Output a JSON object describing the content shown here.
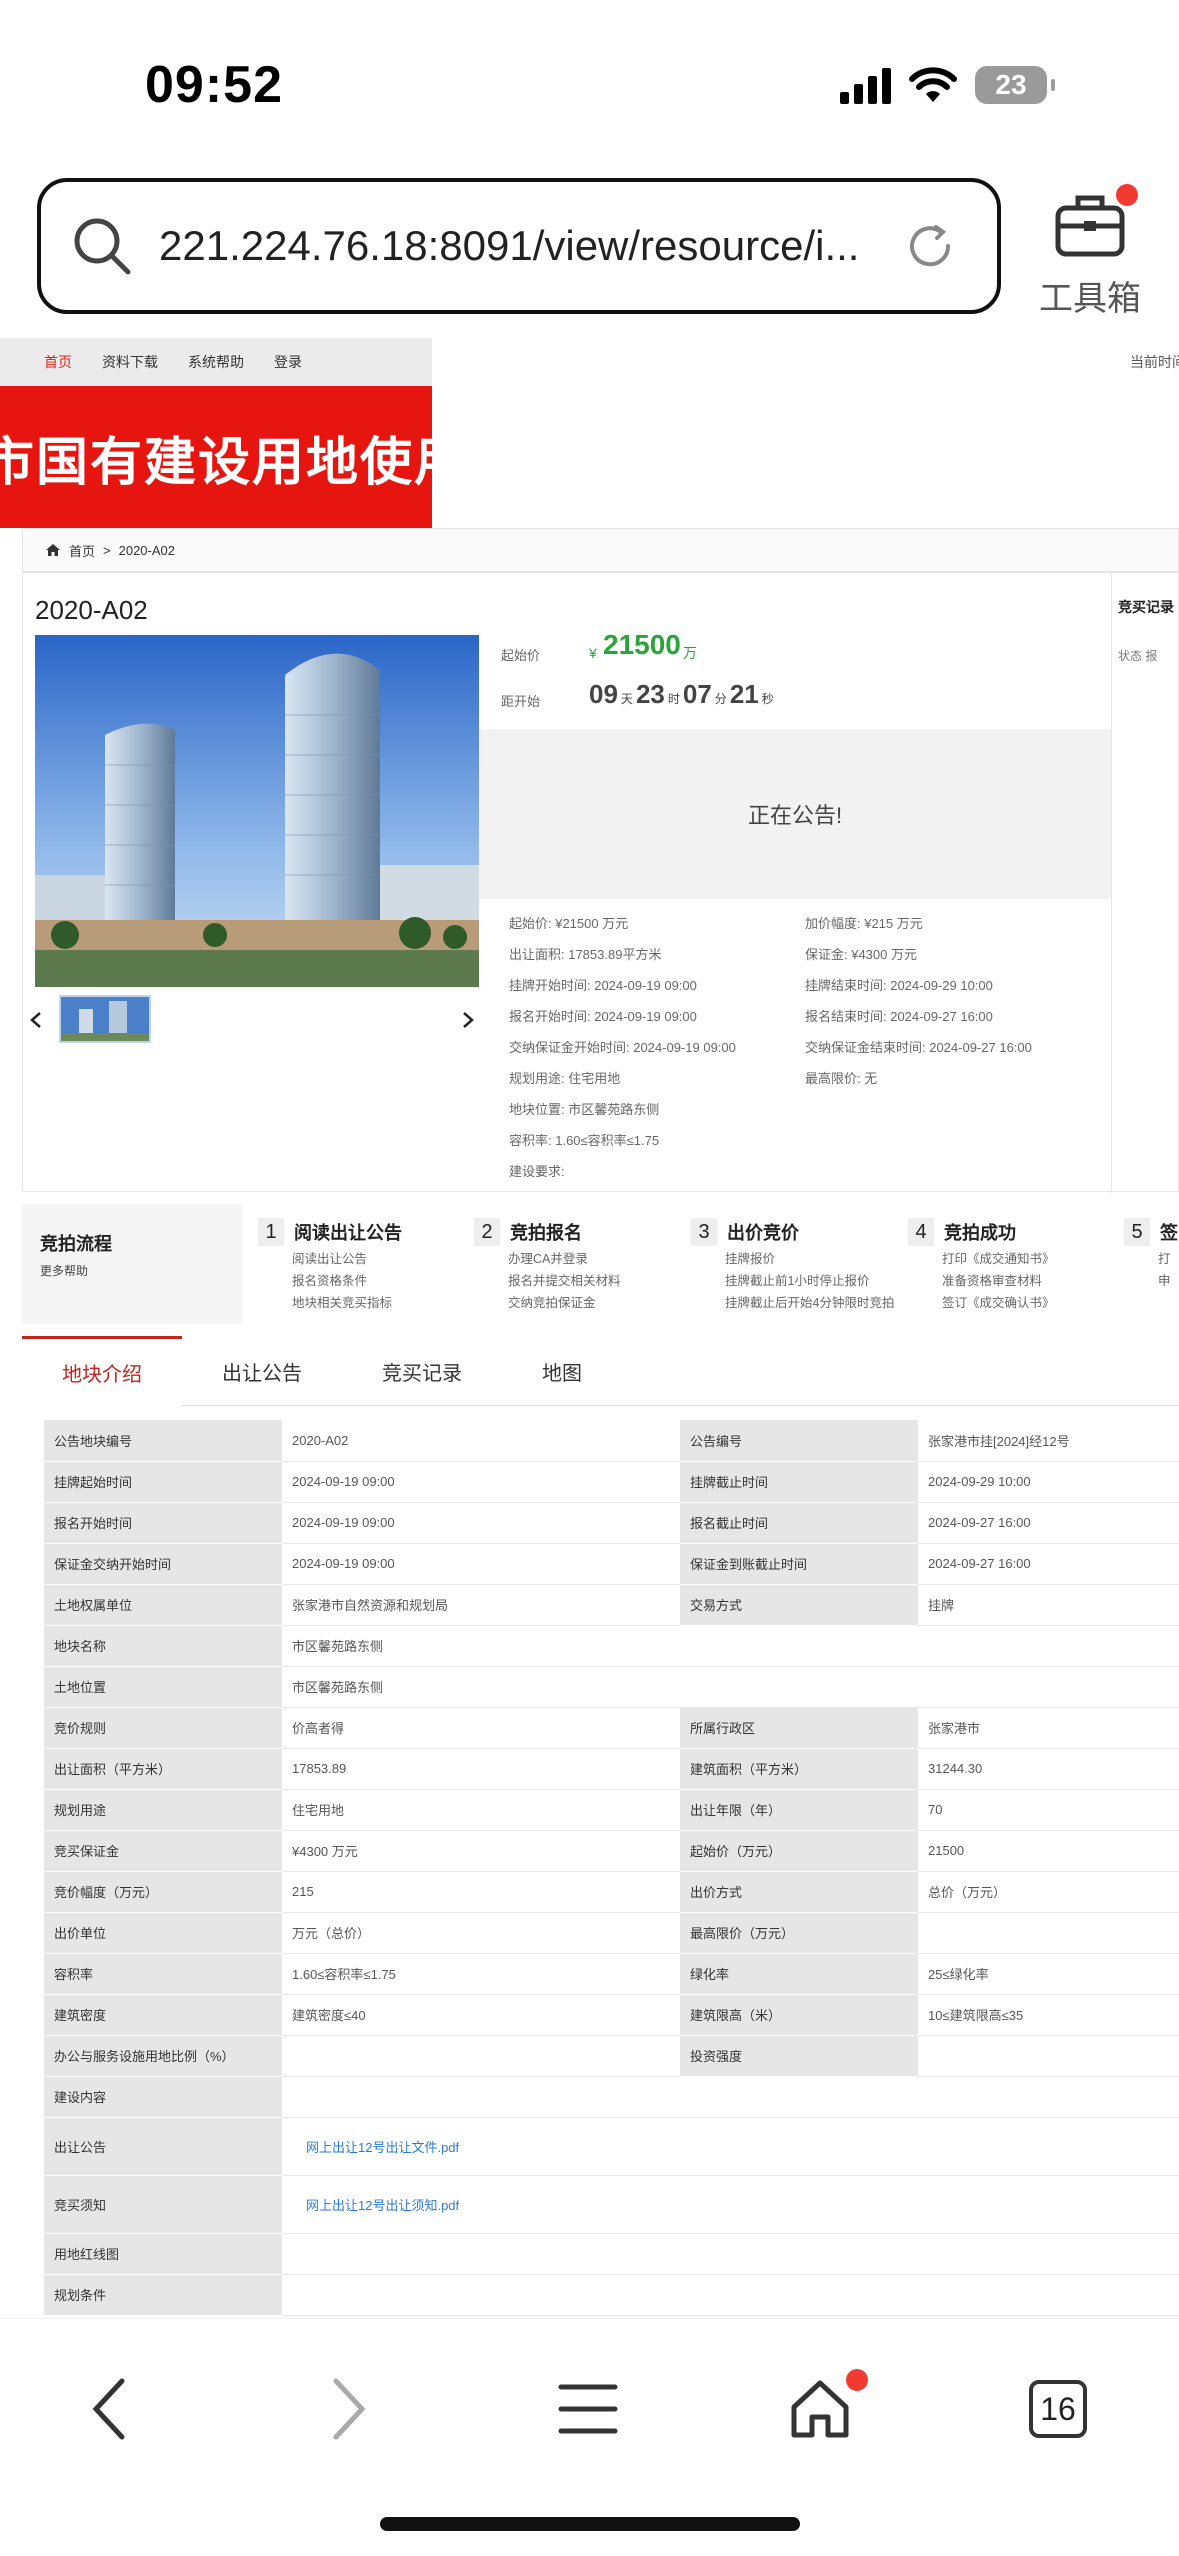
{
  "status": {
    "time": "09:52",
    "battery": "23"
  },
  "browser": {
    "url": "221.224.76.18:8091/view/resource/i...",
    "toolbox_label": "工具箱",
    "tab_count": "16"
  },
  "site": {
    "nav": [
      "首页",
      "资料下载",
      "系统帮助",
      "登录"
    ],
    "nav_right": "当前时间",
    "banner": "市国有建设用地使用"
  },
  "breadcrumb": {
    "home": "首页",
    "sep": ">",
    "current": "2020-A02"
  },
  "lot": {
    "title": "2020-A02",
    "start_price_label": "起始价",
    "currency": "¥",
    "start_price": "21500",
    "price_unit": "万",
    "countdown_label": "距开始",
    "countdown": {
      "days": "09",
      "days_unit": "天",
      "hours": "23",
      "hours_unit": "时",
      "minutes": "07",
      "minutes_unit": "分",
      "seconds": "21",
      "seconds_unit": "秒"
    },
    "status": "正在公告!",
    "details": [
      "起始价: ¥21500 万元",
      "加价幅度: ¥215 万元",
      "出让面积: 17853.89平方米",
      "保证金: ¥4300 万元",
      "挂牌开始时间: 2024-09-19 09:00",
      "挂牌结束时间: 2024-09-29 10:00",
      "报名开始时间: 2024-09-19 09:00",
      "报名结束时间: 2024-09-27 16:00",
      "交纳保证金开始时间: 2024-09-19 09:00",
      "交纳保证金结束时间: 2024-09-27 16:00",
      "规划用途: 住宅用地",
      "最高限价: 无",
      "地块位置: 市区馨苑路东侧",
      "容积率: 1.60≤容积率≤1.75",
      "建设要求:"
    ],
    "side_title": "竞买记录",
    "side_cols": "状态  报"
  },
  "flow": {
    "title": "竞拍流程",
    "help": "更多帮助",
    "steps": [
      {
        "num": "1",
        "title": "阅读出让公告",
        "items": [
          "阅读出让公告",
          "报名资格条件",
          "地块相关竞买指标"
        ]
      },
      {
        "num": "2",
        "title": "竞拍报名",
        "items": [
          "办理CA并登录",
          "报名并提交相关材料",
          "交纳竞拍保证金"
        ]
      },
      {
        "num": "3",
        "title": "出价竞价",
        "items": [
          "挂牌报价",
          "挂牌截止前1小时停止报价",
          "挂牌截止后开始4分钟限时竞拍"
        ]
      },
      {
        "num": "4",
        "title": "竞拍成功",
        "items": [
          "打印《成交通知书》",
          "准备资格审查材料",
          "签订《成交确认书》"
        ]
      },
      {
        "num": "5",
        "title": "签",
        "items": [
          "打",
          "申"
        ]
      }
    ]
  },
  "tabs": [
    "地块介绍",
    "出让公告",
    "竞买记录",
    "地图"
  ],
  "table": [
    [
      "公告地块编号",
      "2020-A02",
      "公告编号",
      "张家港市挂[2024]经12号"
    ],
    [
      "挂牌起始时间",
      "2024-09-19 09:00",
      "挂牌截止时间",
      "2024-09-29 10:00"
    ],
    [
      "报名开始时间",
      "2024-09-19 09:00",
      "报名截止时间",
      "2024-09-27 16:00"
    ],
    [
      "保证金交纳开始时间",
      "2024-09-19 09:00",
      "保证金到账截止时间",
      "2024-09-27 16:00"
    ],
    [
      "土地权属单位",
      "张家港市自然资源和规划局",
      "交易方式",
      "挂牌"
    ],
    [
      "地块名称",
      "市区馨苑路东侧"
    ],
    [
      "土地位置",
      "市区馨苑路东侧"
    ],
    [
      "竞价规则",
      "价高者得",
      "所属行政区",
      "张家港市"
    ],
    [
      "出让面积（平方米）",
      "17853.89",
      "建筑面积（平方米）",
      "31244.30"
    ],
    [
      "规划用途",
      "住宅用地",
      "出让年限（年）",
      "70"
    ],
    [
      "竞买保证金",
      "¥4300 万元",
      "起始价（万元）",
      "21500"
    ],
    [
      "竞价幅度（万元）",
      "215",
      "出价方式",
      "总价（万元）"
    ],
    [
      "出价单位",
      "万元（总价）",
      "最高限价（万元）",
      ""
    ],
    [
      "容积率",
      "1.60≤容积率≤1.75",
      "绿化率",
      "25≤绿化率"
    ],
    [
      "建筑密度",
      "建筑密度≤40",
      "建筑限高（米）",
      "10≤建筑限高≤35"
    ],
    [
      "办公与服务设施用地比例（%）",
      "",
      "投资强度",
      ""
    ],
    [
      "建设内容",
      ""
    ],
    [
      "出让公告",
      "网上出让12号出让文件.pdf"
    ],
    [
      "竞买须知",
      "网上出让12号出让须知.pdf"
    ],
    [
      "用地红线图",
      ""
    ],
    [
      "规划条件",
      ""
    ]
  ],
  "colors": {
    "accent_red": "#e6150f",
    "price_green": "#2aa53a",
    "link_blue": "#2a7bd3"
  }
}
